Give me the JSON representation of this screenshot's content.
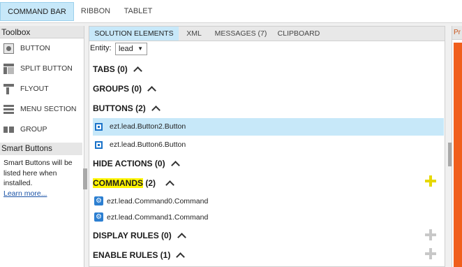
{
  "top_tabs": [
    "COMMAND BAR",
    "RIBBON",
    "TABLET"
  ],
  "toolbox": {
    "title": "Toolbox",
    "items": [
      {
        "label": "BUTTON",
        "icon": "button-icon"
      },
      {
        "label": "SPLIT BUTTON",
        "icon": "split-button-icon"
      },
      {
        "label": "FLYOUT",
        "icon": "flyout-icon"
      },
      {
        "label": "MENU SECTION",
        "icon": "menu-section-icon"
      },
      {
        "label": "GROUP",
        "icon": "group-icon"
      }
    ],
    "smart_buttons_title": "Smart Buttons",
    "smart_buttons_text": "Smart Buttons will be listed here when installed.",
    "learn_more": "Learn more..."
  },
  "center": {
    "tabs": [
      "SOLUTION ELEMENTS",
      "XML",
      "MESSAGES (7)",
      "CLIPBOARD"
    ],
    "entity_label": "Entity:",
    "entity_value": "lead",
    "sections": {
      "tabs": "TABS (0)",
      "groups": "GROUPS (0)",
      "buttons": "BUTTONS (2)",
      "hide_actions": "HIDE ACTIONS (0)",
      "commands_word": "COMMANDS",
      "commands_count": " (2)",
      "display_rules": "DISPLAY RULES (0)",
      "enable_rules": "ENABLE RULES (1)"
    },
    "buttons": [
      "ezt.lead.Button2.Button",
      "ezt.lead.Button6.Button"
    ],
    "commands": [
      "ezt.lead.Command0.Command",
      "ezt.lead.Command1.Command"
    ]
  },
  "right_panel": {
    "title": "Pr"
  },
  "colors": {
    "accent_tab": "#c7e8f9",
    "highlight": "#fff500",
    "plus_active": "#e6d800",
    "plus_inactive": "#c8c8c8",
    "orange": "#f05f1d",
    "icon_blue": "#1a73c9"
  }
}
